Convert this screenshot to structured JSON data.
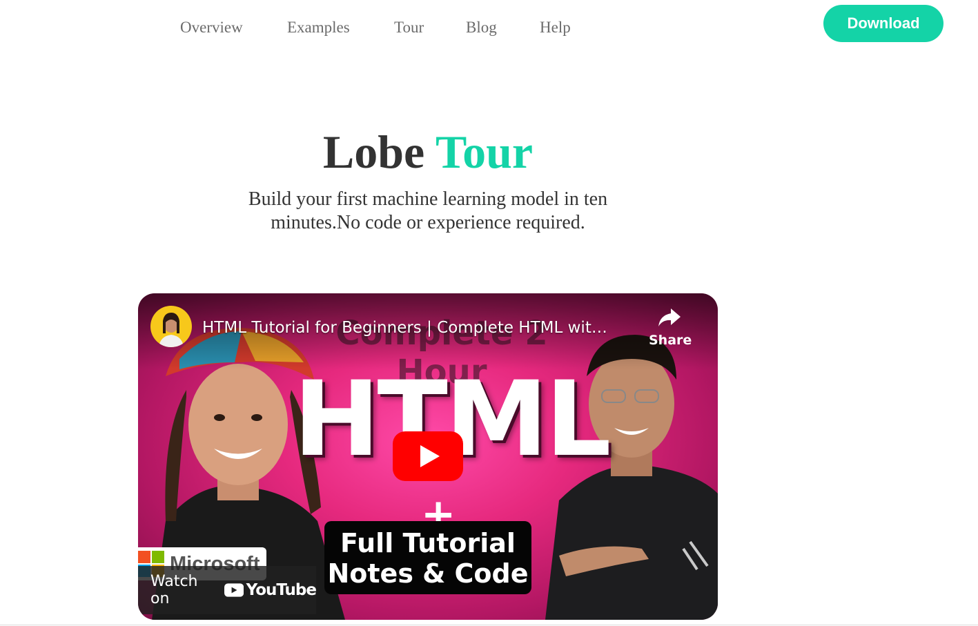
{
  "nav": {
    "links": [
      "Overview",
      "Examples",
      "Tour",
      "Blog",
      "Help"
    ],
    "download_label": "Download",
    "accent_color": "#14d3a7"
  },
  "hero": {
    "title_main": "Lobe",
    "title_accent": "Tour",
    "subtitle": "Build your first machine learning model in ten minutes.No code or experience required."
  },
  "video": {
    "title": "HTML Tutorial for Beginners | Complete HTML wit…",
    "share_label": "Share",
    "thumbnail": {
      "ghost_text": "Complete 2 Hour",
      "big_text": "HTML",
      "plus": "+",
      "box_line1": "Full Tutorial",
      "box_line2": "Notes &  Code",
      "background_color": "#e6297e"
    },
    "sponsor": "Microsoft",
    "watch_on_label": "Watch on",
    "youtube_label": "YouTube",
    "play_icon": "youtube-play-icon"
  }
}
